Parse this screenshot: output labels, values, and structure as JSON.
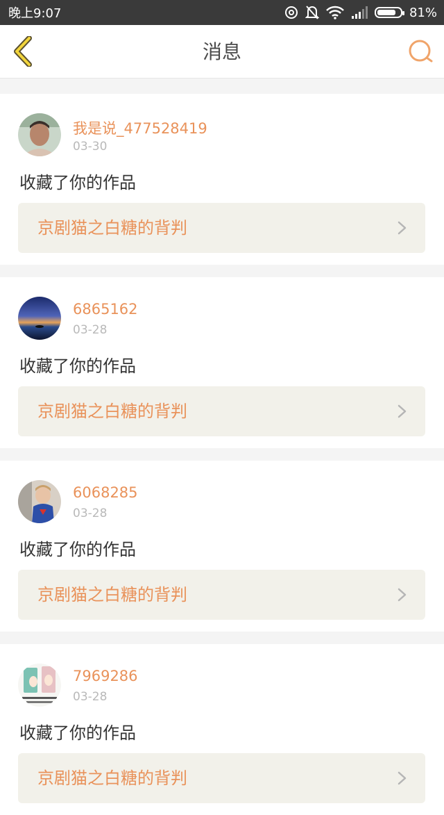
{
  "status_bar": {
    "time": "晚上9:07",
    "battery_percent": "81%",
    "battery_level": 0.81
  },
  "nav": {
    "title": "消息",
    "back_icon": "chevron-left-icon",
    "search_icon": "search-icon",
    "accent": "#e9925a"
  },
  "messages": [
    {
      "username": "我是说_477528419",
      "date": "03-30",
      "action": "收藏了你的作品",
      "work_title": "京剧猫之白糖的背判"
    },
    {
      "username": "6865162",
      "date": "03-28",
      "action": "收藏了你的作品",
      "work_title": "京剧猫之白糖的背判"
    },
    {
      "username": "6068285",
      "date": "03-28",
      "action": "收藏了你的作品",
      "work_title": "京剧猫之白糖的背判"
    },
    {
      "username": "7969286",
      "date": "03-28",
      "action": "收藏了你的作品",
      "work_title": "京剧猫之白糖的背判"
    }
  ]
}
